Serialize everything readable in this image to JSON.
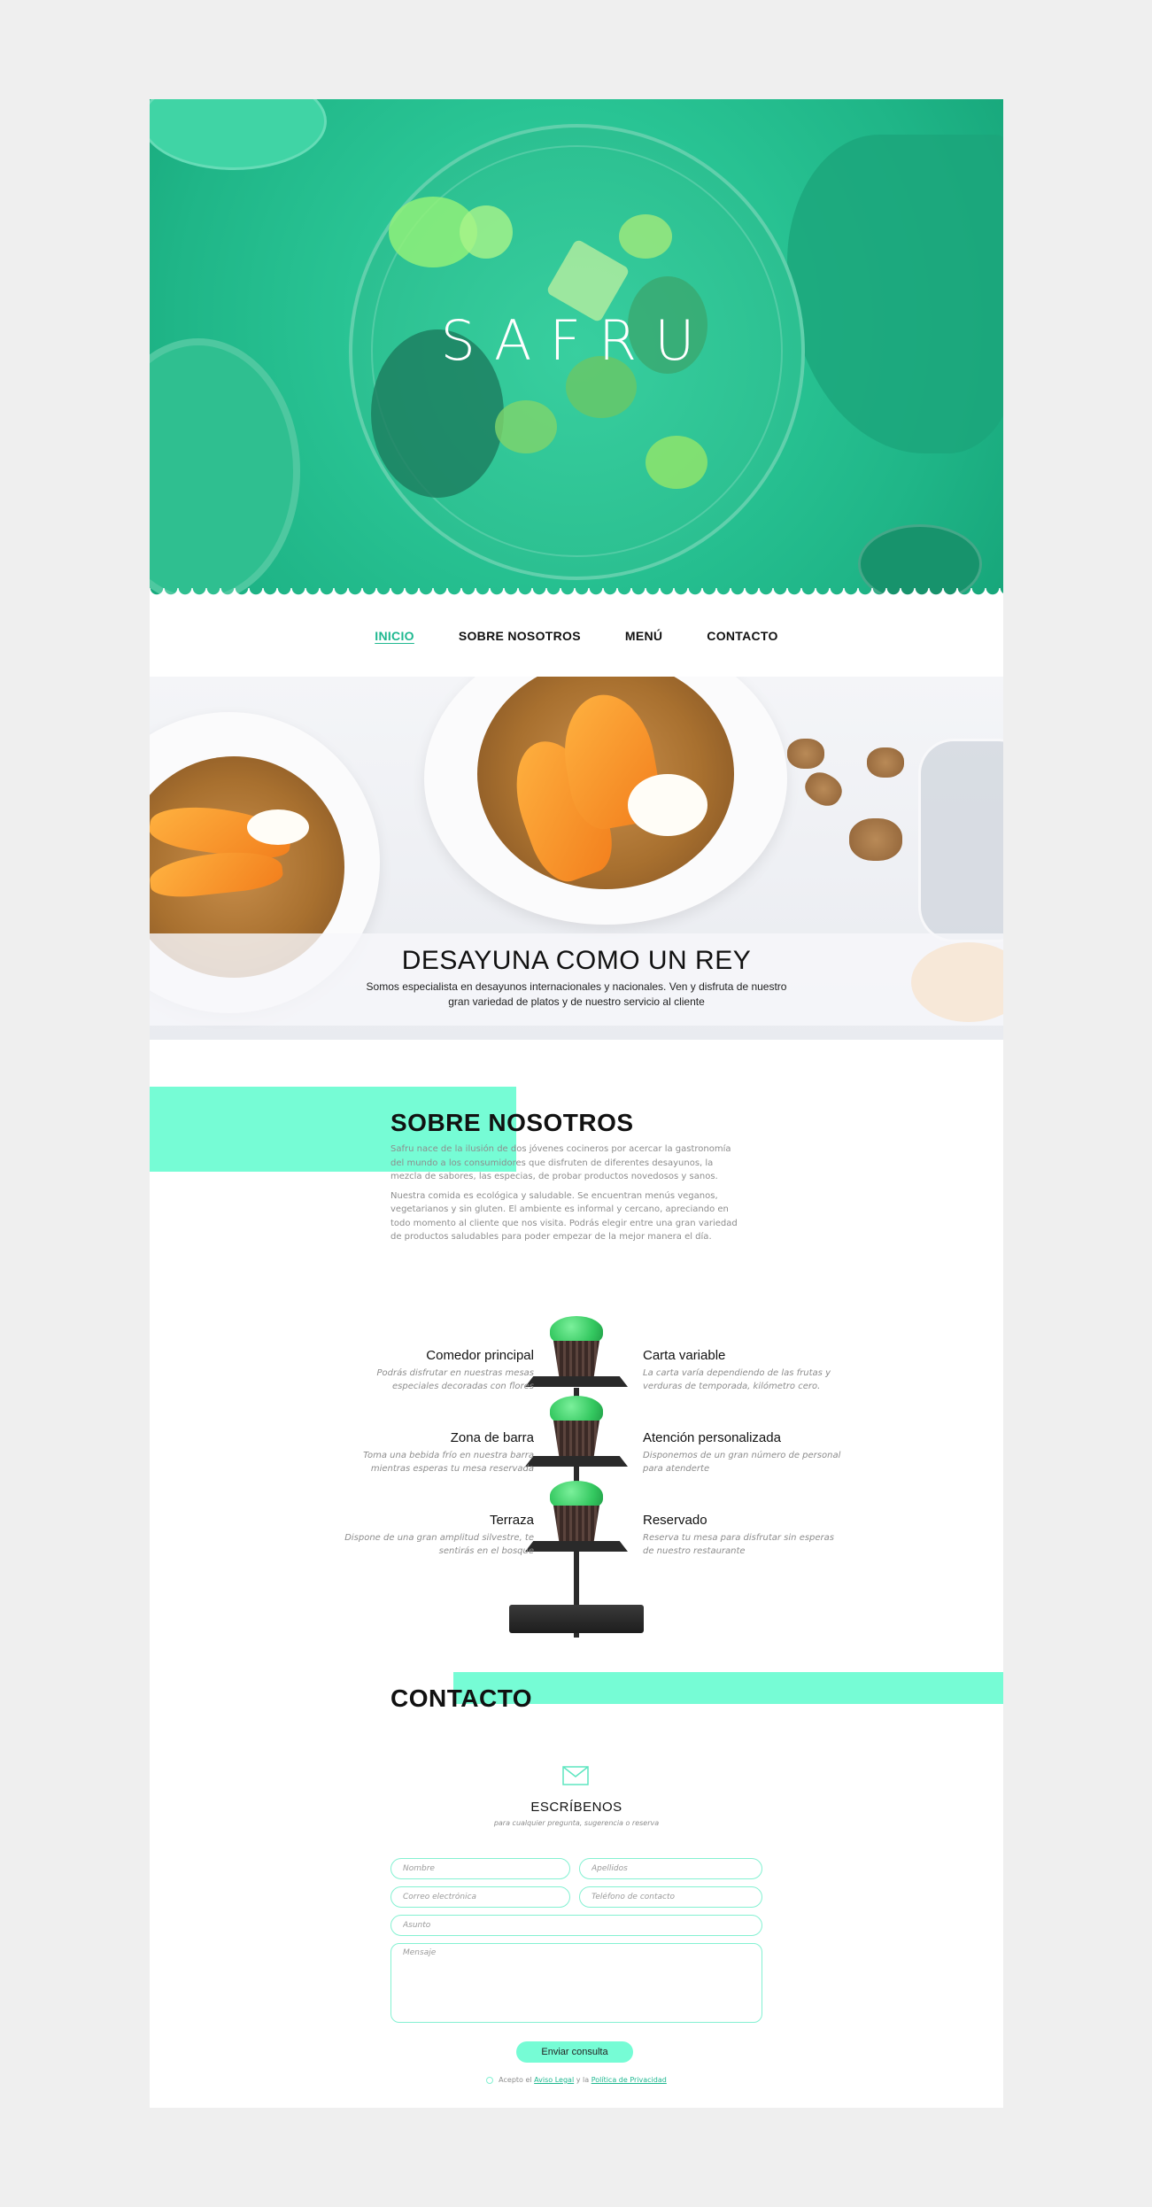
{
  "hero": {
    "logo": "SAFRU"
  },
  "nav": {
    "items": [
      {
        "label": "INICIO",
        "active": true
      },
      {
        "label": "SOBRE NOSOTROS",
        "active": false
      },
      {
        "label": "MENÚ",
        "active": false
      },
      {
        "label": "CONTACTO",
        "active": false
      }
    ]
  },
  "banner": {
    "title": "DESAYUNA COMO UN REY",
    "text": "Somos especialista en desayunos internacionales y nacionales. Ven y disfruta de nuestro gran variedad de platos y de nuestro servicio al cliente"
  },
  "about": {
    "title": "SOBRE NOSOTROS",
    "p1": "Safru nace de la ilusión de dos jóvenes cocineros por acercar la gastronomía del mundo a los consumidores que disfruten de diferentes desayunos, la mezcla de sabores, las especias, de probar productos novedosos y sanos.",
    "p2": "Nuestra comida es ecológica y saludable. Se encuentran menús veganos, vegetarianos y sin gluten. El ambiente es informal y cercano, apreciando en todo momento al cliente que nos visita. Podrás elegir entre una gran variedad de productos saludables para poder empezar de la mejor manera el día."
  },
  "features": {
    "left": [
      {
        "title": "Comedor principal",
        "text": "Podrás disfrutar en nuestras mesas especiales  decoradas con flores"
      },
      {
        "title": "Zona de barra",
        "text": "Toma una bebida frío en nuestra barra mientras esperas tu mesa reservada"
      },
      {
        "title": "Terraza",
        "text": "Dispone de  una gran amplitud silvestre, te sentirás en el bosque"
      }
    ],
    "right": [
      {
        "title": "Carta variable",
        "text": "La carta varía dependiendo de las frutas y verduras de temporada, kilómetro cero."
      },
      {
        "title": "Atención personalizada",
        "text": "Disponemos de un gran número de personal para atenderte"
      },
      {
        "title": "Reservado",
        "text": "Reserva tu mesa para disfrutar sin esperas de nuestro restaurante"
      }
    ]
  },
  "contact": {
    "title": "CONTACTO",
    "heading": "ESCRÍBENOS",
    "subheading": "para cualquier pregunta, sugerencia o reserva",
    "fields": {
      "nombre": "Nombre",
      "apellidos": "Apellidos",
      "email": "Correo electrónica",
      "telefono": "Teléfono de contacto",
      "asunto": "Asunto",
      "mensaje": "Mensaje"
    },
    "submit": "Enviar consulta",
    "legal_prefix": "Acepto el",
    "legal_link1": "Aviso Legal",
    "legal_mid": "y la",
    "legal_link2": "Política de Privacidad"
  },
  "colors": {
    "accent": "#76fcd5",
    "hero": "#29c494",
    "link": "#1fb890"
  }
}
